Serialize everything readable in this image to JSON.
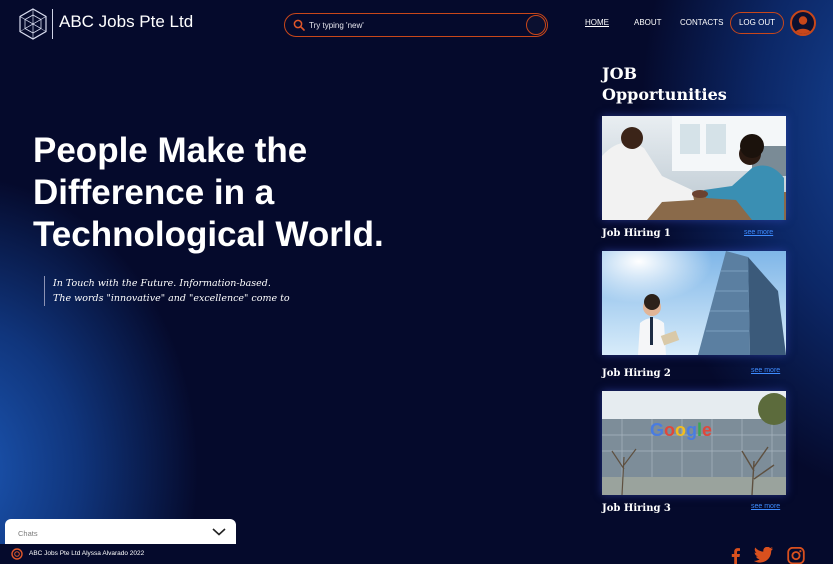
{
  "header": {
    "brand": "ABC Jobs Pte Ltd",
    "search": {
      "placeholder": "Try typing 'new'"
    },
    "nav": {
      "home": "HOME",
      "about": "ABOUT",
      "contacts": "CONTACTS"
    },
    "logout_label": "LOG OUT",
    "icons": {
      "logo": "geometric-logo-icon",
      "search": "search-icon",
      "avatar": "user-avatar-icon"
    }
  },
  "hero": {
    "title_lines": [
      "People Make the",
      "Difference in a",
      "Technological World."
    ],
    "quote_lines": [
      "In Touch with the Future. Information-based.",
      "The words \"innovative\" and \"excellence\" come to"
    ]
  },
  "jobs": {
    "heading_lines": [
      "JOB",
      "Opportunities"
    ],
    "items": [
      {
        "title": "Job Hiring 1",
        "link": "see more",
        "image": "handshake-office-photo"
      },
      {
        "title": "Job Hiring 2",
        "link": "see more",
        "image": "businessman-skyscraper-photo"
      },
      {
        "title": "Job Hiring 3",
        "link": "see more",
        "image": "google-office-building-photo"
      }
    ]
  },
  "chats": {
    "label": "Chats",
    "icon": "chevron-down-icon"
  },
  "footer": {
    "text": "ABC Jobs Pte Ltd Alyssa Alvarado 2022",
    "icons": [
      "facebook-icon",
      "twitter-icon",
      "instagram-icon"
    ]
  },
  "colors": {
    "accent": "#c8471a",
    "background": "#050a2c",
    "link": "#3e8cff",
    "glow": "#1c58b6"
  }
}
